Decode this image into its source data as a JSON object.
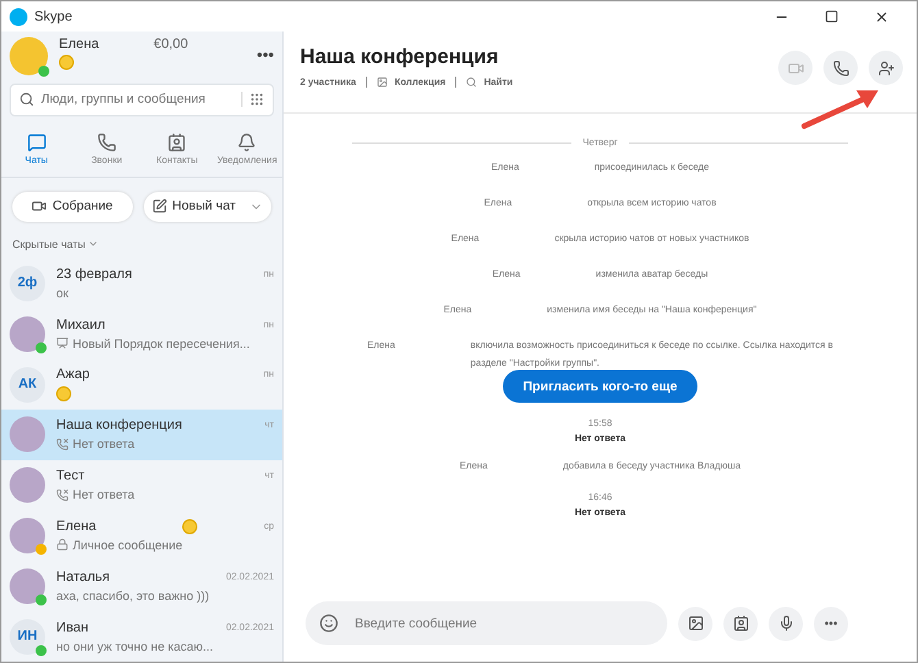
{
  "window": {
    "title": "Skype"
  },
  "profile": {
    "name": "Елена",
    "balance": "€0,00",
    "color": "#3cc24a",
    "menu": "•••"
  },
  "search": {
    "placeholder": "Люди, группы и сообщения"
  },
  "nav_tabs": [
    {
      "label": "Чаты",
      "selected": true
    },
    {
      "label": "Звонки",
      "selected": false
    },
    {
      "label": "Контакты",
      "selected": false
    },
    {
      "label": "Уведомления",
      "selected": false
    }
  ],
  "actions": [
    {
      "label": "Собрание",
      "dropdown": false
    },
    {
      "label": "Новый чат",
      "dropdown": true
    }
  ],
  "section_label": "Скрытые чаты",
  "chats": [
    {
      "name": "23 февраля",
      "initials": "2ф",
      "preview": "ок",
      "kind": "text",
      "date": "пн",
      "name_emoji": false,
      "selected": false
    },
    {
      "name": "Михаил",
      "preview": "Новый Порядок пересечения...",
      "kind": "slides",
      "date": "пн",
      "color": "#3cc24a",
      "name_emoji": false,
      "selected": false
    },
    {
      "name": "Ажар",
      "initials": "АК",
      "kind": "emoji",
      "date": "пн",
      "name_emoji": false,
      "selected": false
    },
    {
      "name": "Наша конференция",
      "preview": "Нет ответа",
      "kind": "missed",
      "date": "чт",
      "name_emoji": false,
      "selected": true
    },
    {
      "name": "Тест",
      "preview": "Нет ответа",
      "kind": "missed",
      "date": "чт",
      "name_emoji": false,
      "selected": false
    },
    {
      "name": "Елена",
      "preview": "Личное сообщение",
      "kind": "lock",
      "date": "ср",
      "color": "#f5b400",
      "name_emoji": true,
      "selected": false
    },
    {
      "name": "Наталья",
      "preview": "аха, спасибо, это важно )))",
      "kind": "text",
      "date": "02.02.2021",
      "color": "#3cc24a",
      "name_emoji": false,
      "selected": false
    },
    {
      "name": "Иван",
      "initials": "ИН",
      "preview": "но они уж точно не касаю...",
      "kind": "text",
      "date": "02.02.2021",
      "color": "#3cc24a",
      "name_emoji": false,
      "selected": false
    }
  ],
  "conversation": {
    "title": "Наша конференция",
    "participants": "2 участника",
    "gallery": "Коллекция",
    "find": "Найти"
  },
  "day_divider": "Четверг",
  "messages": [
    {
      "kind": "event",
      "name": "Елена",
      "text": "присоединилась к беседе"
    },
    {
      "kind": "event",
      "name": "Елена",
      "text": "открыла всем историю чатов"
    },
    {
      "kind": "event",
      "name": "Елена",
      "text": "скрыла историю чатов от новых участников"
    },
    {
      "kind": "event",
      "name": "Елена",
      "text": "изменила аватар беседы"
    },
    {
      "kind": "event",
      "name": "Елена",
      "text": "изменила имя беседы на \"Наша конференция\""
    },
    {
      "kind": "event",
      "name": "Елена",
      "text": "включила возможность присоединиться к беседе по ссылке. Ссылка находится в разделе \"Настройки группы\"."
    },
    {
      "kind": "invite",
      "text": "Пригласить кого-то еще"
    },
    {
      "kind": "call",
      "time": "15:58",
      "text": "Нет ответа"
    },
    {
      "kind": "event",
      "name": "Елена",
      "text": "добавила в беседу участника Владюша"
    },
    {
      "kind": "call",
      "time": "16:46",
      "text": "Нет ответа"
    }
  ],
  "composer": {
    "placeholder": "Введите сообщение",
    "more": "•••"
  }
}
